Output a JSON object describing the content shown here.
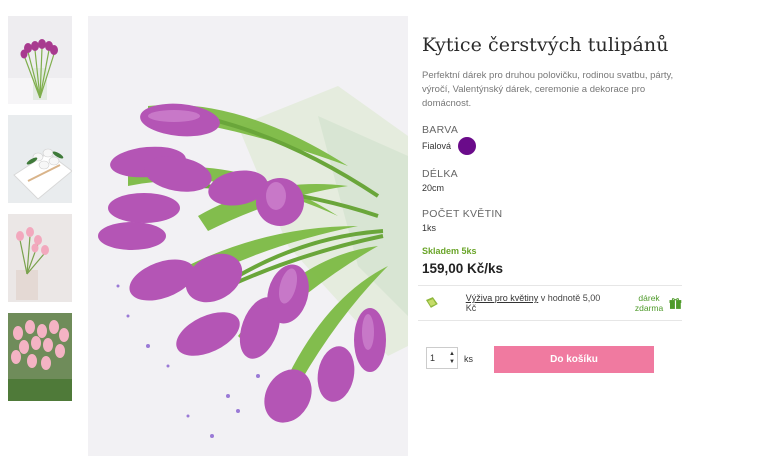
{
  "product": {
    "title": "Kytice čerstvých tulipánů",
    "description": "Perfektní dárek pro druhou polovičku, rodinou svatbu, párty, výročí, Valentýnský dárek, ceremonie a dekorace pro domácnost.",
    "attributes": {
      "color": {
        "label": "BARVA",
        "value": "Fialová",
        "swatch": "#6a0b8a"
      },
      "length": {
        "label": "DÉLKA",
        "value": "20cm"
      },
      "count": {
        "label": "POČET KVĚTIN",
        "value": "1ks"
      }
    },
    "stock": "Skladem 5ks",
    "price": "159,00 Kč/ks"
  },
  "gift": {
    "link": "Výživa pro květiny",
    "text": " v hodnotě 5,00 Kč",
    "free_line1": "dárek",
    "free_line2": "zdarma"
  },
  "cart": {
    "qty": "1",
    "unit": "ks",
    "button": "Do košíku"
  },
  "colors": {
    "accent": "#f07aa0",
    "stock": "#6aa529",
    "gift": "#4e9a2a"
  },
  "thumbnails": [
    {
      "icon": "purple-tulips-vase-image"
    },
    {
      "icon": "white-tulips-box-image"
    },
    {
      "icon": "pink-tulips-vase-image"
    },
    {
      "icon": "pink-tulips-bouquet-image"
    }
  ]
}
